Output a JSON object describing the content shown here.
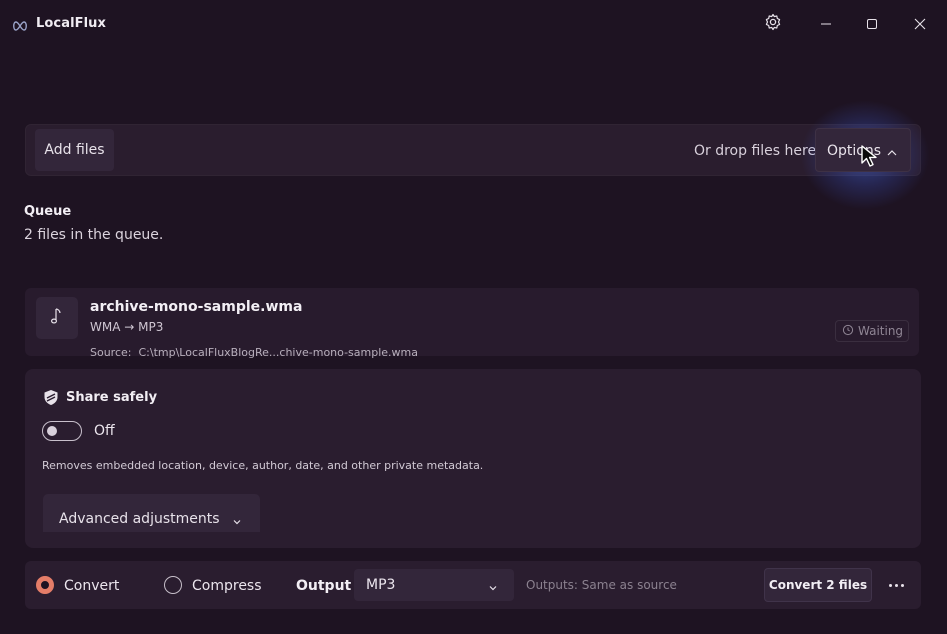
{
  "app": {
    "title": "LocalFlux"
  },
  "toolbar": {
    "add_files_label": "Add files",
    "drop_text": "Or drop files here",
    "options_label": "Options"
  },
  "queue": {
    "title": "Queue",
    "count_text": "2 files in the queue.",
    "items": [
      {
        "name": "archive-mono-sample.wma",
        "conversion": "WMA → MP3",
        "source_label": "Source:",
        "source_path": "C:\\tmp\\LocalFluxBlogRe...chive-mono-sample.wma",
        "status": "Waiting"
      }
    ]
  },
  "share": {
    "title": "Share safely",
    "toggle_state": "Off",
    "description": "Removes embedded location, device, author, date, and other private metadata.",
    "advanced_label": "Advanced adjustments"
  },
  "bottom": {
    "mode_convert": "Convert",
    "mode_compress": "Compress",
    "selected_mode": "Convert",
    "output_label": "Output",
    "format_value": "MP3",
    "outputs_text": "Outputs: Same as source",
    "convert_button": "Convert 2 files"
  },
  "colors": {
    "background": "#1e1322",
    "panel": "#2a1d2f",
    "accent": "#e47d68",
    "glow": "#466ee6"
  },
  "icons": {
    "app": "infinity-icon",
    "settings": "gear-icon",
    "minimize": "minimize-icon",
    "maximize": "maximize-icon",
    "close": "close-icon",
    "file": "music-note-icon",
    "status": "clock-icon",
    "share": "shield-icon"
  }
}
